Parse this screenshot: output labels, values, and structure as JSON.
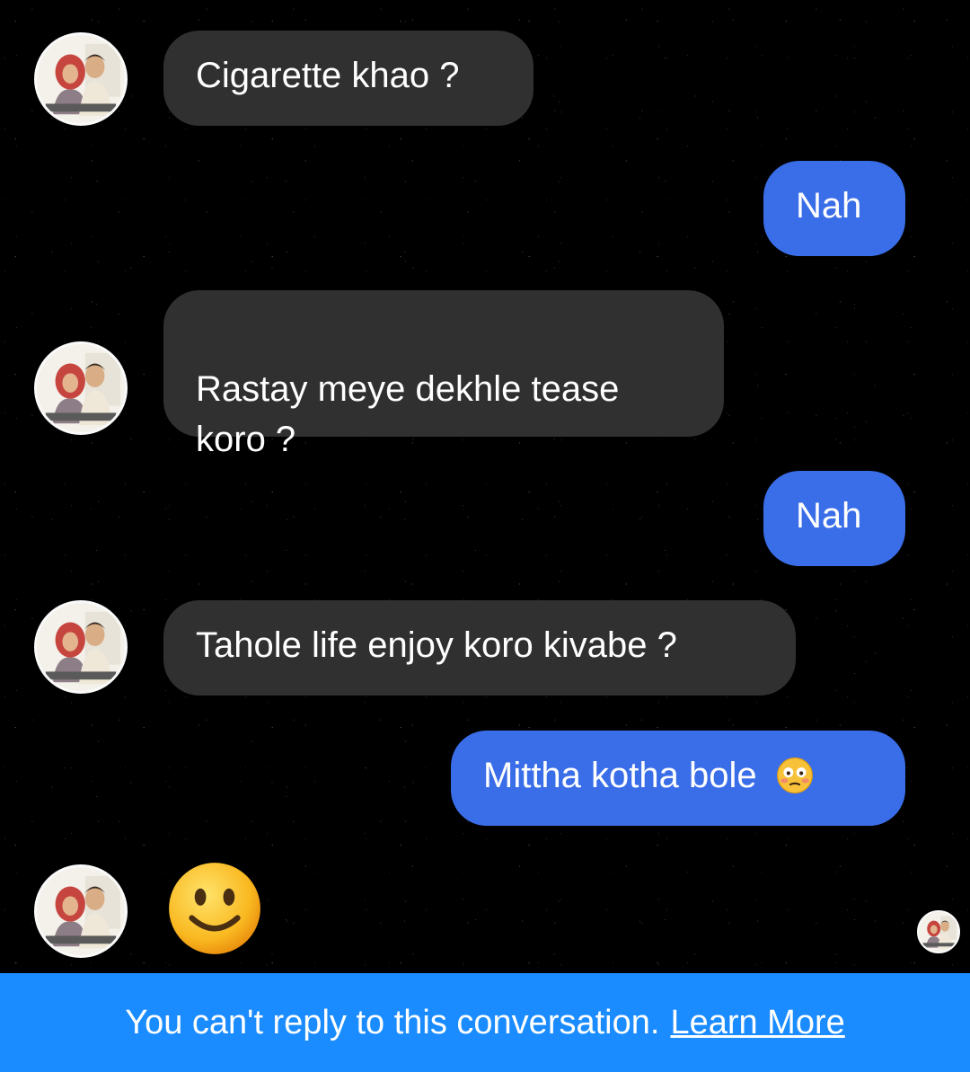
{
  "messages": [
    {
      "side": "incoming",
      "text": "Cigarette khao ?"
    },
    {
      "side": "outgoing",
      "text": "Nah"
    },
    {
      "side": "incoming",
      "text": "Rastay meye dekhle tease\nkoro ?"
    },
    {
      "side": "outgoing",
      "text": "Nah"
    },
    {
      "side": "incoming",
      "text": "Tahole life enjoy koro kivabe ?"
    },
    {
      "side": "outgoing",
      "text": "Mittha kotha bole",
      "emoji": "flushed-face-icon"
    },
    {
      "side": "incoming",
      "emoji": "slightly-smiling-face-icon"
    }
  ],
  "footer": {
    "notice": "You can't reply to this conversation.",
    "link": "Learn More"
  },
  "colors": {
    "background": "#000000",
    "incoming_bubble": "#303030",
    "outgoing_bubble": "#3a6ee8",
    "footer": "#1a8cff"
  }
}
